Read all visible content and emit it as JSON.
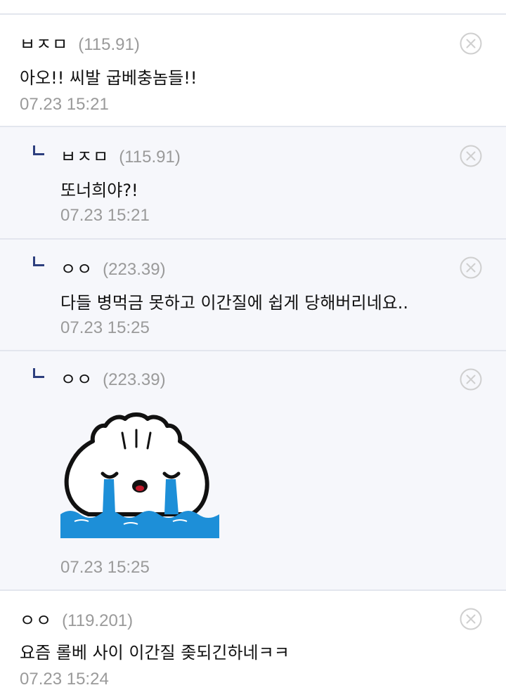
{
  "comments": [
    {
      "nick": "ㅂㅈㅁ",
      "ip": "(115.91)",
      "text": "아오!! 씨발 굽베충놈들!!",
      "time": "07.23 15:21"
    },
    {
      "nick": "ㅂㅈㅁ",
      "ip": "(115.91)",
      "text": "또너희야?!",
      "time": "07.23 15:21"
    },
    {
      "nick": "ㅇㅇ",
      "ip": "(223.39)",
      "text": "다들 병먹금 못하고 이간질에 쉽게 당해버리네요..",
      "time": "07.23 15:25"
    },
    {
      "nick": "ㅇㅇ",
      "ip": "(223.39)",
      "sticker": "crying-dumpling",
      "time": "07.23 15:25"
    },
    {
      "nick": "ㅇㅇ",
      "ip": "(119.201)",
      "text": "요즘 롤베 사이 이간질 좆되긴하네ㅋㅋ",
      "time": "07.23 15:24"
    }
  ]
}
